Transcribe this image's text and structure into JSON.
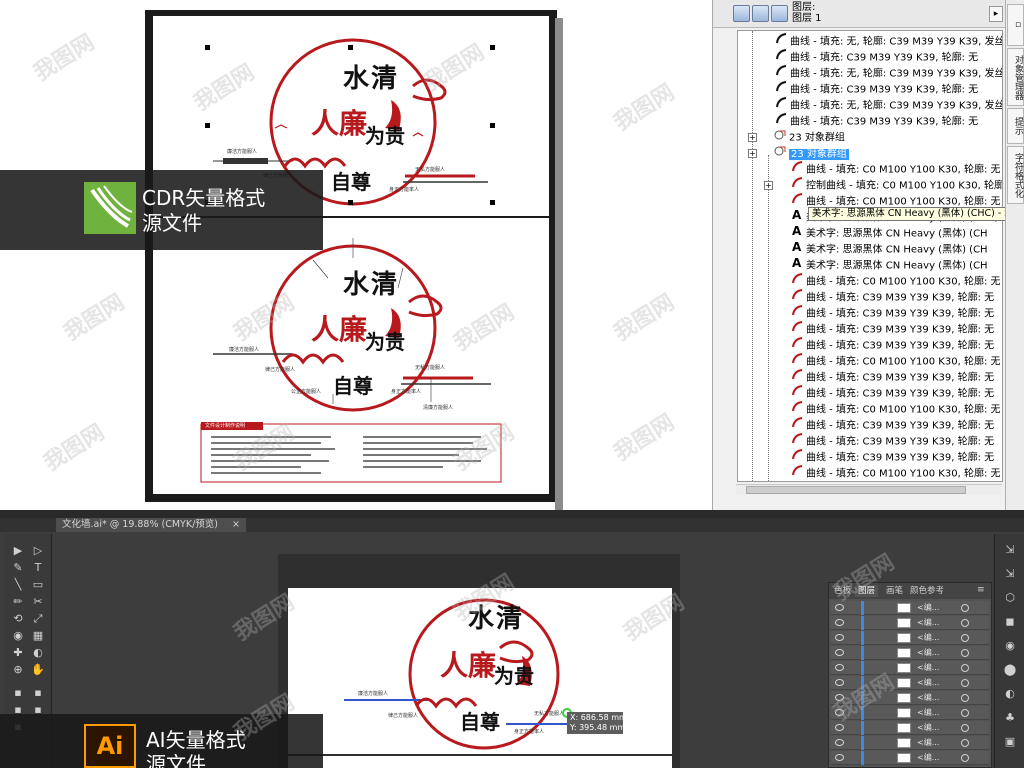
{
  "cdr": {
    "layer_header": [
      "图层:",
      "图层 1"
    ],
    "tree_rows": [
      {
        "type": "curve",
        "text": "曲线 - 填充: 无, 轮廓: C39 M39 Y39 K39, 发丝"
      },
      {
        "type": "curve",
        "text": "曲线 - 填充: C39 M39 Y39 K39, 轮廓: 无"
      },
      {
        "type": "curve",
        "text": "曲线 - 填充: 无, 轮廓: C39 M39 Y39 K39, 发丝"
      },
      {
        "type": "curve",
        "text": "曲线 - 填充: C39 M39 Y39 K39, 轮廓: 无"
      },
      {
        "type": "curve",
        "text": "曲线 - 填充: 无, 轮廓: C39 M39 Y39 K39, 发丝"
      },
      {
        "type": "curve",
        "text": "曲线 - 填充: C39 M39 Y39 K39, 轮廓: 无"
      },
      {
        "type": "group",
        "text": "23 对象群组"
      },
      {
        "type": "group-selected",
        "text": "23 对象群组"
      },
      {
        "type": "curve-red",
        "text": "曲线 - 填充: C0 M100 Y100 K30, 轮廓: 无"
      },
      {
        "type": "control-curve",
        "text": "控制曲线 - 填充: C0 M100 Y100 K30, 轮廓"
      },
      {
        "type": "curve-red",
        "text": "曲线 - 填充: C0 M100 Y100 K30, 轮廓: 无"
      },
      {
        "type": "art-text",
        "text": "美术字: 思源黑体 CN Heavy (黑体) (CHC) - 填充"
      },
      {
        "type": "art-text",
        "text": "美术字: 思源黑体 CN Heavy (黑体) (CH"
      },
      {
        "type": "art-text",
        "text": "美术字: 思源黑体 CN Heavy (黑体) (CH"
      },
      {
        "type": "art-text",
        "text": "美术字: 思源黑体 CN Heavy (黑体) (CH"
      },
      {
        "type": "curve-red",
        "text": "曲线 - 填充: C0 M100 Y100 K30, 轮廓: 无"
      },
      {
        "type": "curve-red",
        "text": "曲线 - 填充: C39 M39 Y39 K39, 轮廓: 无"
      },
      {
        "type": "curve-red",
        "text": "曲线 - 填充: C39 M39 Y39 K39, 轮廓: 无"
      },
      {
        "type": "curve-red",
        "text": "曲线 - 填充: C39 M39 Y39 K39, 轮廓: 无"
      },
      {
        "type": "curve-red",
        "text": "曲线 - 填充: C39 M39 Y39 K39, 轮廓: 无"
      },
      {
        "type": "curve-red",
        "text": "曲线 - 填充: C0 M100 Y100 K30, 轮廓: 无"
      },
      {
        "type": "curve-red",
        "text": "曲线 - 填充: C39 M39 Y39 K39, 轮廓: 无"
      },
      {
        "type": "curve-red",
        "text": "曲线 - 填充: C39 M39 Y39 K39, 轮廓: 无"
      },
      {
        "type": "curve-red",
        "text": "曲线 - 填充: C0 M100 Y100 K30, 轮廓: 无"
      },
      {
        "type": "curve-red",
        "text": "曲线 - 填充: C39 M39 Y39 K39, 轮廓: 无"
      },
      {
        "type": "curve-red",
        "text": "曲线 - 填充: C39 M39 Y39 K39, 轮廓: 无"
      },
      {
        "type": "curve-red",
        "text": "曲线 - 填充: C39 M39 Y39 K39, 轮廓: 无"
      },
      {
        "type": "curve-red",
        "text": "曲线 - 填充: C0 M100 Y100 K30, 轮廓: 无"
      },
      {
        "type": "curve-red",
        "text": "曲线 - 填充: C0 M100 Y100 K30, 轮廓: 无"
      },
      {
        "type": "curve-red",
        "text": "曲线 - 填充: C39 M39 Y39 K39, 轮廓: 无"
      },
      {
        "type": "control-curve",
        "text": "控制曲线 - 填充: C0 M100 Y100 K30, 轮廓"
      }
    ],
    "tooltip": "美术字: 思源黑体 CN Heavy (黑体) (CHC) - 填充",
    "side_tabs": [
      "对象管理器",
      "提示",
      "字符格式化"
    ],
    "label": [
      "CDR矢量格式",
      "源文件"
    ],
    "artwork": {
      "calligraphy_top": "水清",
      "calligraphy_mid": "人廉",
      "calligraphy_right": "为贵",
      "calligraphy_bottom": "自尊",
      "caption_box_title": "文件设计制作说明",
      "annotations": [
        "廉洁方能服人",
        "律己方能服人",
        "身正方能率人",
        "无私方能服人",
        "公正方能服人",
        "清廉方能服人"
      ]
    }
  },
  "ai": {
    "doc_tab": "文化墙.ai* @ 19.88% (CMYK/预览)",
    "label": [
      "AI矢量格式",
      "源文件"
    ],
    "coord_tip": [
      "X: 686.58 mm",
      "Y: 395.48 mm"
    ],
    "panel_tabs": [
      "色板",
      "图层",
      "画笔",
      "颜色参考"
    ],
    "layer_rows": [
      "<编...",
      "<编...",
      "<编...",
      "<编...",
      "<编...",
      "<编...",
      "<编...",
      "<编...",
      "<编...",
      "<编...",
      "<编..."
    ],
    "tools": [
      "▶",
      "▷",
      "✎",
      "T",
      "╲",
      "▭",
      "✏",
      "✂",
      "⟲",
      "⤢",
      "◉",
      "▦",
      "✚",
      "◐",
      "⊕",
      "✋"
    ]
  },
  "watermark": "我图网",
  "colors": {
    "red": "#b8191d",
    "cdr_green": "#6fb23e",
    "ai_orange": "#ff9a00",
    "selection_blue": "#3399ff"
  }
}
